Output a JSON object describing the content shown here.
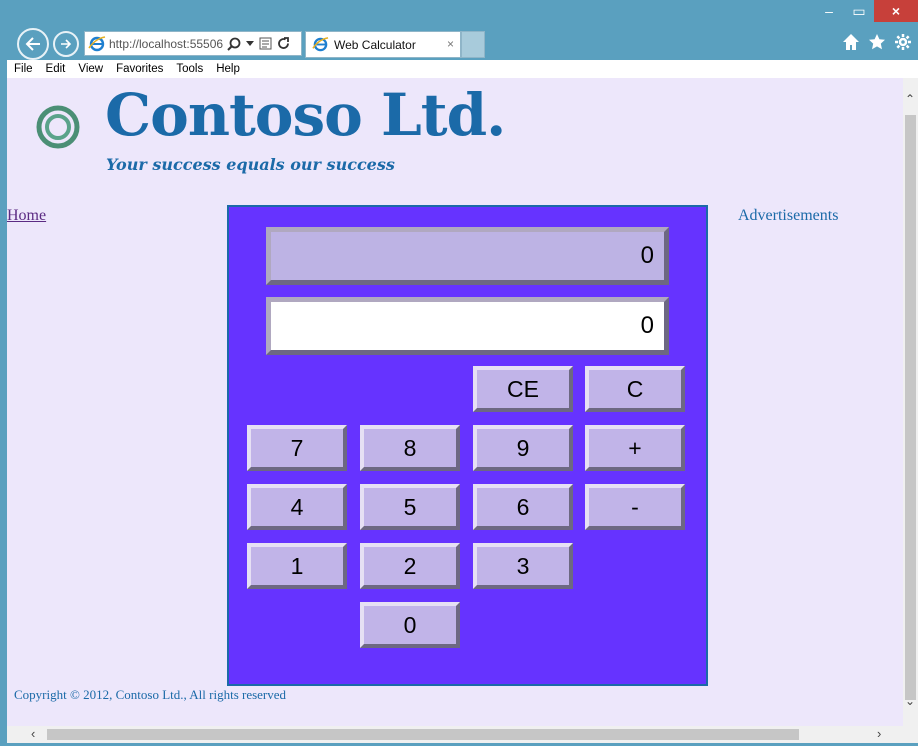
{
  "browser": {
    "url": "http://localhost:55506",
    "tab_title": "Web Calculator",
    "tab_close": "×",
    "menu": [
      "File",
      "Edit",
      "View",
      "Favorites",
      "Tools",
      "Help"
    ],
    "window_controls": {
      "minimize": "–",
      "maximize": "▭",
      "close": "×"
    },
    "icons": [
      "back-icon",
      "forward-icon",
      "search-icon",
      "dropdown-icon",
      "compatibility-icon",
      "refresh-icon",
      "home-icon",
      "favorites-star-icon",
      "settings-gear-icon"
    ]
  },
  "page": {
    "site_title": "Contoso Ltd.",
    "tagline": "Your success equals our success",
    "nav_home": "Home",
    "sidebar_right": "Advertisements",
    "copyright": "Copyright © 2012, Contoso Ltd., All rights reserved"
  },
  "calculator": {
    "previous_value": "0",
    "current_value": "0",
    "keys": {
      "ce": "CE",
      "c": "C",
      "k7": "7",
      "k8": "8",
      "k9": "9",
      "plus": "+",
      "k4": "4",
      "k5": "5",
      "k6": "6",
      "minus": "-",
      "k1": "1",
      "k2": "2",
      "k3": "3",
      "k0": "0"
    }
  },
  "colors": {
    "calculator_bg": "#6633ff",
    "key_bg": "#c1b4e8",
    "page_bg": "#ede7fb",
    "brand_blue": "#1b6aa8",
    "chrome": "#5aa0bf"
  }
}
